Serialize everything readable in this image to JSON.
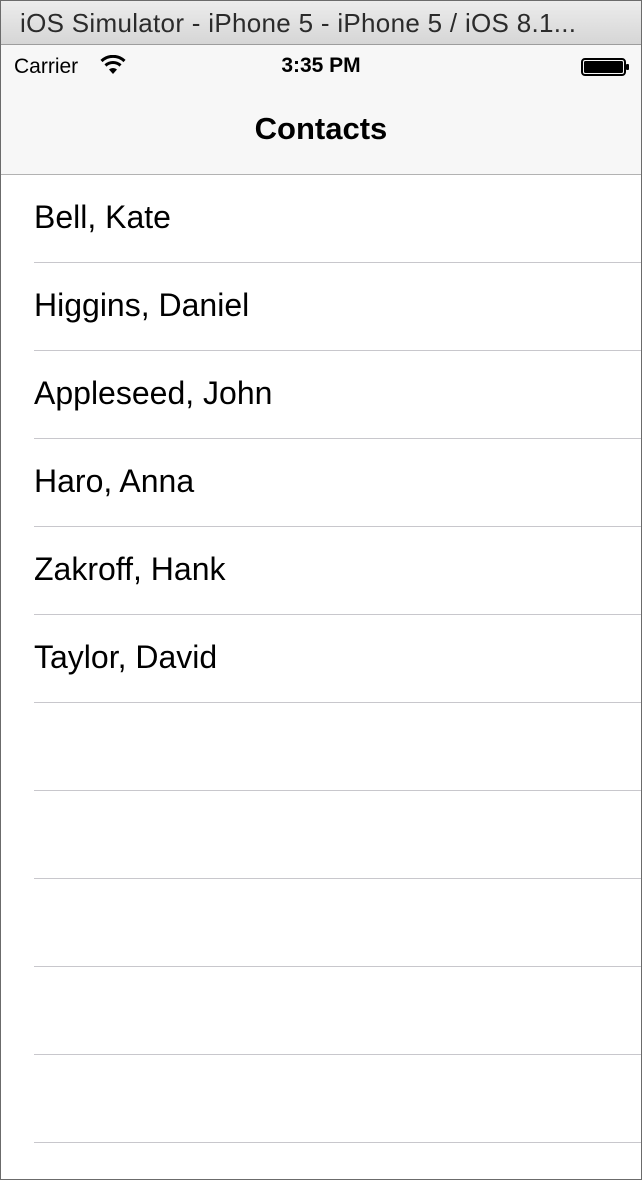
{
  "window": {
    "title": "iOS Simulator - iPhone 5 - iPhone 5 / iOS 8.1..."
  },
  "status_bar": {
    "carrier": "Carrier",
    "time": "3:35 PM",
    "wifi_icon": "wifi-icon",
    "battery_icon": "battery-icon"
  },
  "nav_bar": {
    "title": "Contacts"
  },
  "contacts": [
    {
      "name": "Bell, Kate"
    },
    {
      "name": "Higgins, Daniel"
    },
    {
      "name": "Appleseed, John"
    },
    {
      "name": "Haro, Anna"
    },
    {
      "name": "Zakroff, Hank"
    },
    {
      "name": "Taylor, David"
    }
  ],
  "empty_rows": 5
}
